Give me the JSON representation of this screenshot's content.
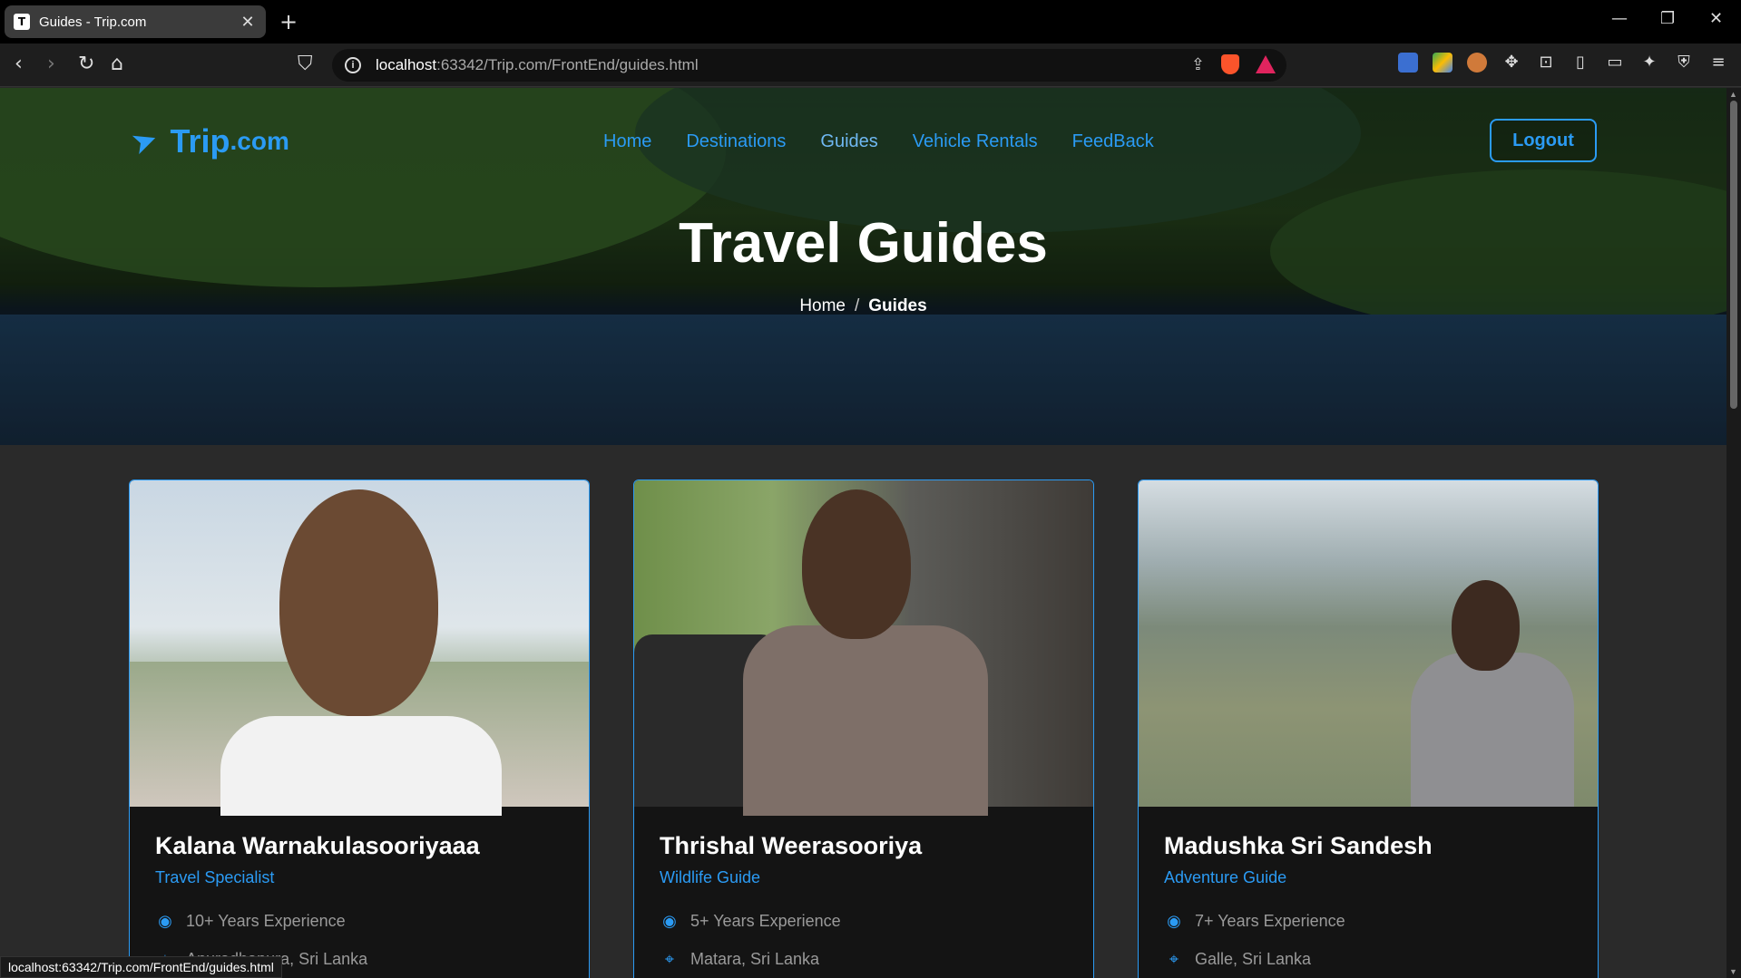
{
  "browser": {
    "tab_title": "Guides - Trip.com",
    "tab_favicon": "T",
    "url_host": "localhost",
    "url_path": ":63342/Trip.com/FrontEnd/guides.html",
    "status_url": "localhost:63342/Trip.com/FrontEnd/guides.html"
  },
  "site": {
    "brand": "Trip",
    "brand_suffix": ".com",
    "nav": [
      "Home",
      "Destinations",
      "Guides",
      "Vehicle Rentals",
      "FeedBack"
    ],
    "logout": "Logout"
  },
  "hero": {
    "title": "Travel Guides",
    "breadcrumb_home": "Home",
    "breadcrumb_sep": "/",
    "breadcrumb_current": "Guides"
  },
  "guides": [
    {
      "name": "Kalana Warnakulasooriyaaa",
      "role": "Travel Specialist",
      "experience": "10+ Years Experience",
      "location": "Anuradhapura, Sri Lanka"
    },
    {
      "name": "Thrishal Weerasooriya",
      "role": "Wildlife Guide",
      "experience": "5+ Years Experience",
      "location": "Matara, Sri Lanka"
    },
    {
      "name": "Madushka Sri Sandesh",
      "role": "Adventure Guide",
      "experience": "7+ Years Experience",
      "location": "Galle, Sri Lanka"
    }
  ],
  "colors": {
    "accent": "#2b9bf4",
    "card_bg": "#141414",
    "page_bg": "#2a2a2a"
  },
  "icons": {
    "experience": "eye-icon",
    "location": "map-pin-icon"
  }
}
